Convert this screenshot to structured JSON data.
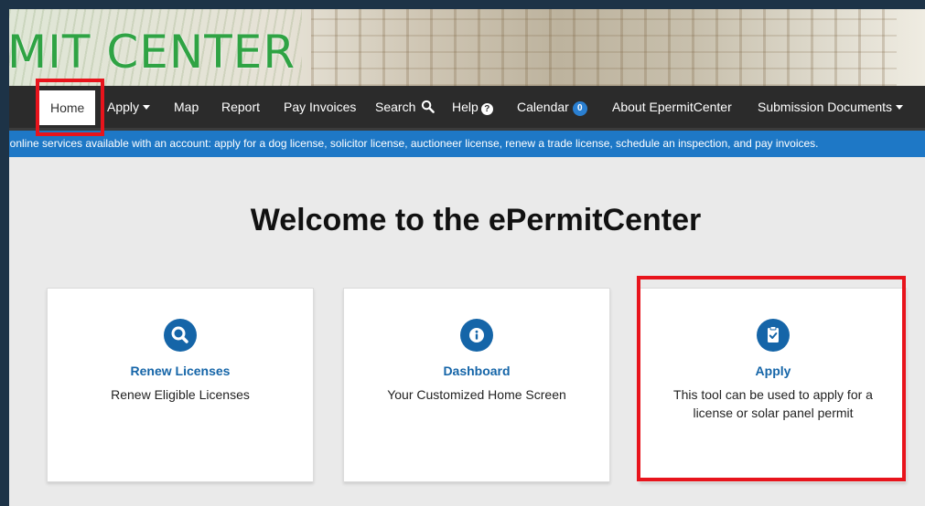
{
  "banner": {
    "site_title": "MIT CENTER"
  },
  "nav": {
    "items": [
      {
        "label": "Home"
      },
      {
        "label": "Apply"
      },
      {
        "label": "Map"
      },
      {
        "label": "Report"
      },
      {
        "label": "Pay Invoices"
      },
      {
        "label": "Search"
      },
      {
        "label": "Help"
      },
      {
        "label": "Calendar",
        "badge": "0"
      },
      {
        "label": "About EpermitCenter"
      },
      {
        "label": "Submission Documents"
      }
    ]
  },
  "info_bar": {
    "text": "t online services available with an account: apply for a dog license, solicitor license, auctioneer license, renew a trade license, schedule an inspection, and pay invoices."
  },
  "main": {
    "heading": "Welcome to the ePermitCenter",
    "cards": [
      {
        "icon": "search-icon",
        "title": "Renew Licenses",
        "description": "Renew Eligible Licenses"
      },
      {
        "icon": "info-icon",
        "title": "Dashboard",
        "description": "Your Customized Home Screen"
      },
      {
        "icon": "clipboard-check-icon",
        "title": "Apply",
        "description": "This tool can be used to apply for a license or solar panel permit"
      }
    ]
  },
  "colors": {
    "nav_background": "#2b2b2b",
    "info_bar": "#1e78c6",
    "card_accent": "#1565a8",
    "title_green": "#2fa344",
    "annotation_red": "#e8141c"
  }
}
